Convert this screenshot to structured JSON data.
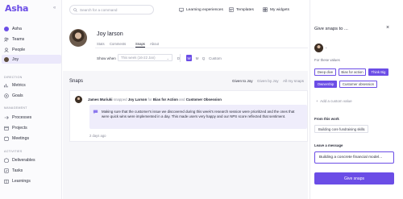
{
  "app": {
    "logo": "Asha"
  },
  "sidebar": {
    "top_items": [
      {
        "label": "Asha",
        "icon": "asha-logo-dot"
      },
      {
        "label": "Teams",
        "icon": "teams-icon"
      },
      {
        "label": "People",
        "icon": "people-icon"
      },
      {
        "label": "Joy",
        "icon": "avatar",
        "active": true
      }
    ],
    "sections": [
      {
        "title": "DIRECTION",
        "items": [
          {
            "label": "Metrics",
            "icon": "chart-icon"
          },
          {
            "label": "Goals",
            "icon": "goal-icon"
          }
        ]
      },
      {
        "title": "MANAGEMENT",
        "items": [
          {
            "label": "Processes",
            "icon": "process-icon"
          },
          {
            "label": "Projects",
            "icon": "projects-icon"
          },
          {
            "label": "Meetings",
            "icon": "meetings-icon"
          }
        ]
      },
      {
        "title": "ACTIVITIES",
        "items": [
          {
            "label": "Deliverables",
            "icon": "deliverables-icon"
          },
          {
            "label": "Tasks",
            "icon": "tasks-icon"
          },
          {
            "label": "Learnings",
            "icon": "learnings-icon"
          }
        ]
      }
    ]
  },
  "topbar": {
    "search_placeholder": "Search for a command",
    "links": [
      {
        "label": "Learning experiences",
        "icon": "learning-icon"
      },
      {
        "label": "Templates",
        "icon": "templates-icon"
      },
      {
        "label": "My widgets",
        "icon": "widgets-icon"
      }
    ]
  },
  "profile": {
    "name": "Joy larson",
    "tabs": [
      "Stats",
      "Comments",
      "Snaps",
      "About"
    ],
    "active_tab": "Snaps",
    "when_label": "Show when",
    "when_value": "This week (16-22 Jan)",
    "periods": [
      "D",
      "W",
      "M",
      "Q"
    ],
    "active_period": "W",
    "custom_label": "Custom"
  },
  "feed": {
    "title": "Snaps",
    "filters": [
      "Given to Joy",
      "Given by Joy",
      "All my snaps"
    ],
    "active_filter": "Given to Joy",
    "snap": {
      "author": "James Muriuki",
      "verb": "snapped",
      "target": "Joy Larson",
      "for": "for",
      "value1": "Bias for Action",
      "and": "and",
      "value2": "Customer Obsession",
      "message": "Making sure that the customer's issue we discovered during this week's research session were prioritized and the ones that were quick wins were implemented in a day. This made users very happy and our NPS score reflected that sentiment.",
      "time": "2 days ago"
    }
  },
  "panel": {
    "title": "Give snaps to ...",
    "close": "×",
    "values_label": "For these values",
    "values": [
      {
        "label": "Deep dive",
        "selected": false
      },
      {
        "label": "Bias for action",
        "selected": false
      },
      {
        "label": "Think Big",
        "selected": true
      },
      {
        "label": "Ownership",
        "selected": true
      },
      {
        "label": "Customer obsession",
        "selected": false
      }
    ],
    "add_value": "Add a custom value",
    "work_label": "From this work",
    "work_value": "Building core fundraising skills",
    "message_label": "Leave a message",
    "message_value": "Building a concrete financial model...",
    "submit": "Give snaps"
  },
  "colors": {
    "accent": "#6b4de6",
    "accent_soft": "#efedfb"
  }
}
